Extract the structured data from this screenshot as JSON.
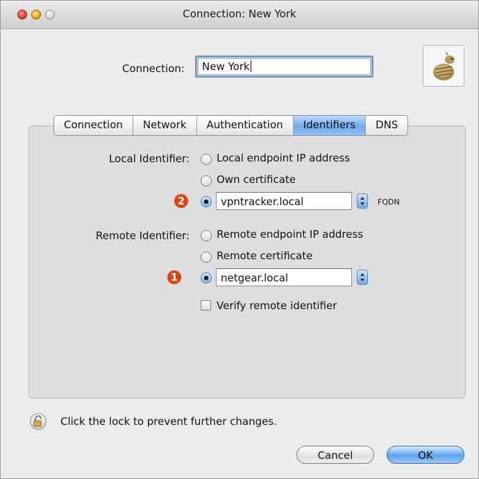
{
  "window": {
    "title": "Connection: New York"
  },
  "connection": {
    "label": "Connection:",
    "value": "New York"
  },
  "tabs": [
    {
      "label": "Connection"
    },
    {
      "label": "Network"
    },
    {
      "label": "Authentication"
    },
    {
      "label": "Identifiers",
      "selected": true
    },
    {
      "label": "DNS"
    }
  ],
  "local_identifier": {
    "label": "Local Identifier:",
    "options": [
      {
        "label": "Local endpoint IP address",
        "checked": false
      },
      {
        "label": "Own certificate",
        "checked": false
      },
      {
        "value": "vpntracker.local",
        "checked": true
      }
    ],
    "type_label": "FQDN",
    "badge": "2"
  },
  "remote_identifier": {
    "label": "Remote Identifier:",
    "options": [
      {
        "label": "Remote endpoint IP address",
        "checked": false
      },
      {
        "label": "Remote certificate",
        "checked": false
      },
      {
        "value": "netgear.local",
        "checked": true
      }
    ],
    "badge": "1"
  },
  "verify": {
    "label": "Verify remote identifier",
    "checked": false
  },
  "footer": {
    "lock_text": "Click the lock to prevent further changes."
  },
  "buttons": {
    "cancel": "Cancel",
    "ok": "OK"
  },
  "colors": {
    "accent": "#6fa9ec",
    "badge": "#e0440e"
  }
}
